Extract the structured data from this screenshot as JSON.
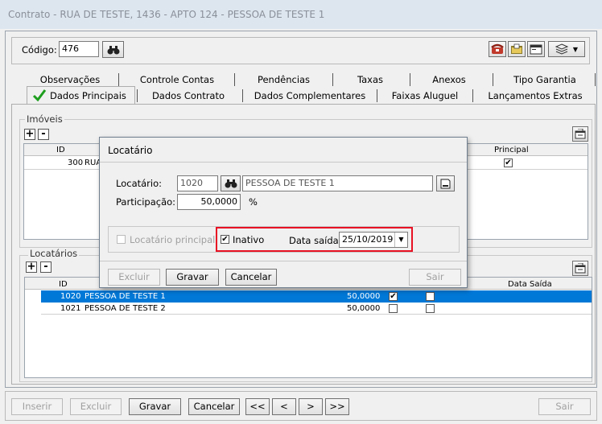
{
  "window": {
    "title": "Contrato - RUA DE TESTE, 1436 - APTO 124 - PESSOA DE TESTE 1"
  },
  "codigo": {
    "label": "Código:",
    "value": "476"
  },
  "tabs_row1": [
    "Observações",
    "Controle Contas",
    "Pendências",
    "Taxas",
    "Anexos",
    "Tipo Garantia"
  ],
  "tabs_row2": [
    "Dados Principais",
    "Dados Contrato",
    "Dados Complementares",
    "Faixas Aluguel",
    "Lançamentos Extras"
  ],
  "imoveis": {
    "title": "Imóveis",
    "col_id": "ID",
    "col_principal": "Principal",
    "rows": [
      {
        "id": "300",
        "name": "RUA",
        "principal": "✔"
      }
    ]
  },
  "locatarios": {
    "title": "Locatários",
    "col_id": "ID",
    "col_data_saida": "Data Saída",
    "rows": [
      {
        "id": "1020",
        "name": "PESSOA DE TESTE 1",
        "participacao": "50,0000",
        "check1": "✔",
        "check2": ""
      },
      {
        "id": "1021",
        "name": "PESSOA DE TESTE 2",
        "participacao": "50,0000",
        "check1": "",
        "check2": ""
      }
    ]
  },
  "dialog": {
    "title": "Locatário",
    "locatario_label": "Locatário:",
    "locatario_id": "1020",
    "locatario_name": "PESSOA DE TESTE 1",
    "participacao_label": "Participação:",
    "participacao_value": "50,0000",
    "percent": "%",
    "principal_label": "Locatário principal",
    "inativo_label": "Inativo",
    "inativo_check": "✔",
    "data_saida_label": "Data saída:",
    "data_saida_value": "25/10/2019",
    "btn_excluir": "Excluir",
    "btn_gravar": "Gravar",
    "btn_cancelar": "Cancelar",
    "btn_sair": "Sair"
  },
  "bottom": {
    "inserir": "Inserir",
    "excluir": "Excluir",
    "gravar": "Gravar",
    "cancelar": "Cancelar",
    "first": "<<",
    "prev": "<",
    "next": ">",
    "last": ">>",
    "sair": "Sair"
  },
  "colors": {
    "selection": "#0078d7",
    "highlight": "#e81123",
    "check_green": "#1e9e1e"
  }
}
